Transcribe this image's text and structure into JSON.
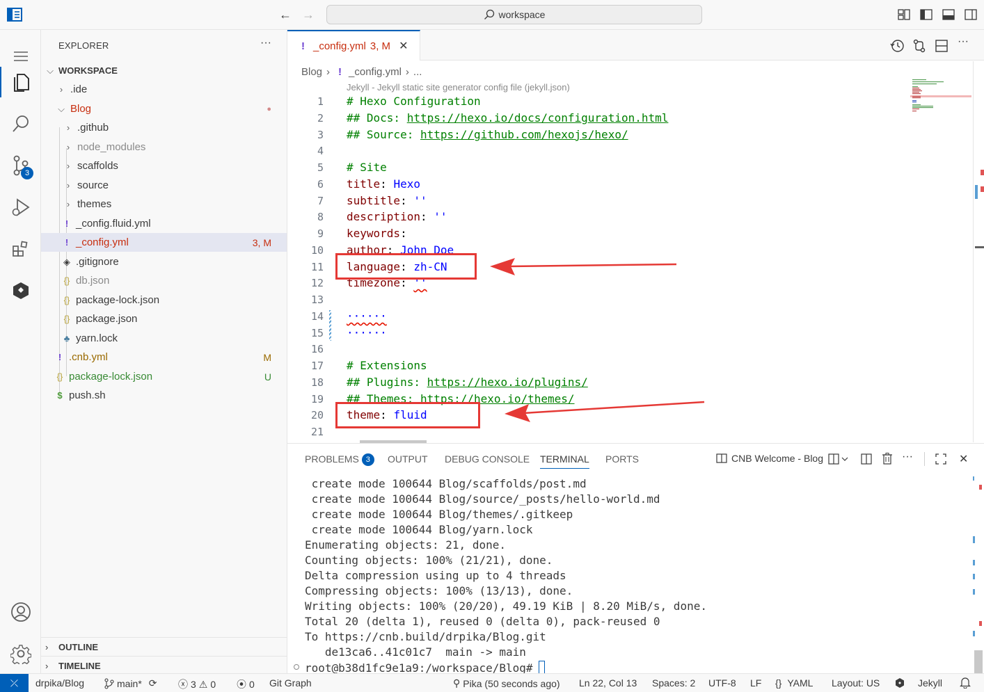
{
  "titlebar": {
    "search_text": "workspace"
  },
  "activity": {
    "scm_badge": "3"
  },
  "explorer": {
    "title": "EXPLORER",
    "more": "···",
    "workspace_label": "WORKSPACE",
    "items": [
      {
        "label": ".ide",
        "deco": ""
      },
      {
        "label": "Blog",
        "deco": "●"
      },
      {
        "label": ".github",
        "deco": ""
      },
      {
        "label": "node_modules",
        "deco": ""
      },
      {
        "label": "scaffolds",
        "deco": ""
      },
      {
        "label": "source",
        "deco": ""
      },
      {
        "label": "themes",
        "deco": ""
      },
      {
        "label": "_config.fluid.yml",
        "deco": ""
      },
      {
        "label": "_config.yml",
        "deco": "3, M"
      },
      {
        "label": ".gitignore",
        "deco": ""
      },
      {
        "label": "db.json",
        "deco": ""
      },
      {
        "label": "package-lock.json",
        "deco": ""
      },
      {
        "label": "package.json",
        "deco": ""
      },
      {
        "label": "yarn.lock",
        "deco": ""
      },
      {
        "label": ".cnb.yml",
        "deco": "M"
      },
      {
        "label": "package-lock.json",
        "deco": "U"
      },
      {
        "label": "push.sh",
        "deco": ""
      }
    ],
    "outline_label": "OUTLINE",
    "timeline_label": "TIMELINE"
  },
  "editor": {
    "tab_label": "_config.yml",
    "tab_deco": "3, M",
    "breadcrumb": [
      "Blog",
      "_config.yml",
      "..."
    ],
    "schema_lens": "Jekyll - Jekyll static site generator config file (jekyll.json)",
    "line_numbers": [
      "1",
      "2",
      "3",
      "4",
      "5",
      "6",
      "7",
      "8",
      "9",
      "10",
      "11",
      "12",
      "13",
      "14",
      "15",
      "16",
      "17",
      "18",
      "19",
      "20",
      "21"
    ],
    "lines": {
      "l1": "# Hexo Configuration",
      "l2a": "## Docs: ",
      "l2b": "https://hexo.io/docs/configuration.html",
      "l3a": "## Source: ",
      "l3b": "https://github.com/hexojs/hexo/",
      "l5": "# Site",
      "l6k": "title",
      "l6v": "Hexo",
      "l7k": "subtitle",
      "l7v": "''",
      "l8k": "description",
      "l8v": "''",
      "l9k": "keywords",
      "l10k": "author",
      "l10v": "John Doe",
      "l11k": "language",
      "l11v": "zh-CN",
      "l12k": "timezone",
      "l12v": "''",
      "l14": "······",
      "l15": "······",
      "l17": "# Extensions",
      "l18a": "## Plugins: ",
      "l18b": "https://hexo.io/plugins/",
      "l19a": "## Themes: ",
      "l19b": "https://hexo.io/themes/",
      "l20k": "theme",
      "l20v": "fluid"
    }
  },
  "panel": {
    "tabs": {
      "problems": "PROBLEMS",
      "problems_count": "3",
      "output": "OUTPUT",
      "debug": "DEBUG CONSOLE",
      "terminal": "TERMINAL",
      "ports": "PORTS"
    },
    "terminal_name": "CNB Welcome - Blog",
    "terminal_lines": [
      " create mode 100644 Blog/scaffolds/post.md",
      " create mode 100644 Blog/source/_posts/hello-world.md",
      " create mode 100644 Blog/themes/.gitkeep",
      " create mode 100644 Blog/yarn.lock",
      "Enumerating objects: 21, done.",
      "Counting objects: 100% (21/21), done.",
      "Delta compression using up to 4 threads",
      "Compressing objects: 100% (13/13), done.",
      "Writing objects: 100% (20/20), 49.19 KiB | 8.20 MiB/s, done.",
      "Total 20 (delta 1), reused 0 (delta 0), pack-reused 0",
      "To https://cnb.build/drpika/Blog.git",
      "   de13ca6..41c01c7  main -> main"
    ],
    "prompt": "root@b38d1fc9e1a9:/workspace/Blog#"
  },
  "statusbar": {
    "repo": "drpika/Blog",
    "branch": "main*",
    "errors": "3",
    "warnings": "0",
    "ports": "0",
    "git_graph": "Git Graph",
    "blame": "Pika (50 seconds ago)",
    "position": "Ln 22, Col 13",
    "spaces": "Spaces: 2",
    "encoding": "UTF-8",
    "eol": "LF",
    "language": "YAML",
    "layout": "Layout: US",
    "schema": "Jekyll"
  },
  "colors": {
    "accent": "#005fb8",
    "modified": "#c72e0f",
    "untracked": "#388a34",
    "annotation": "#e53935"
  }
}
